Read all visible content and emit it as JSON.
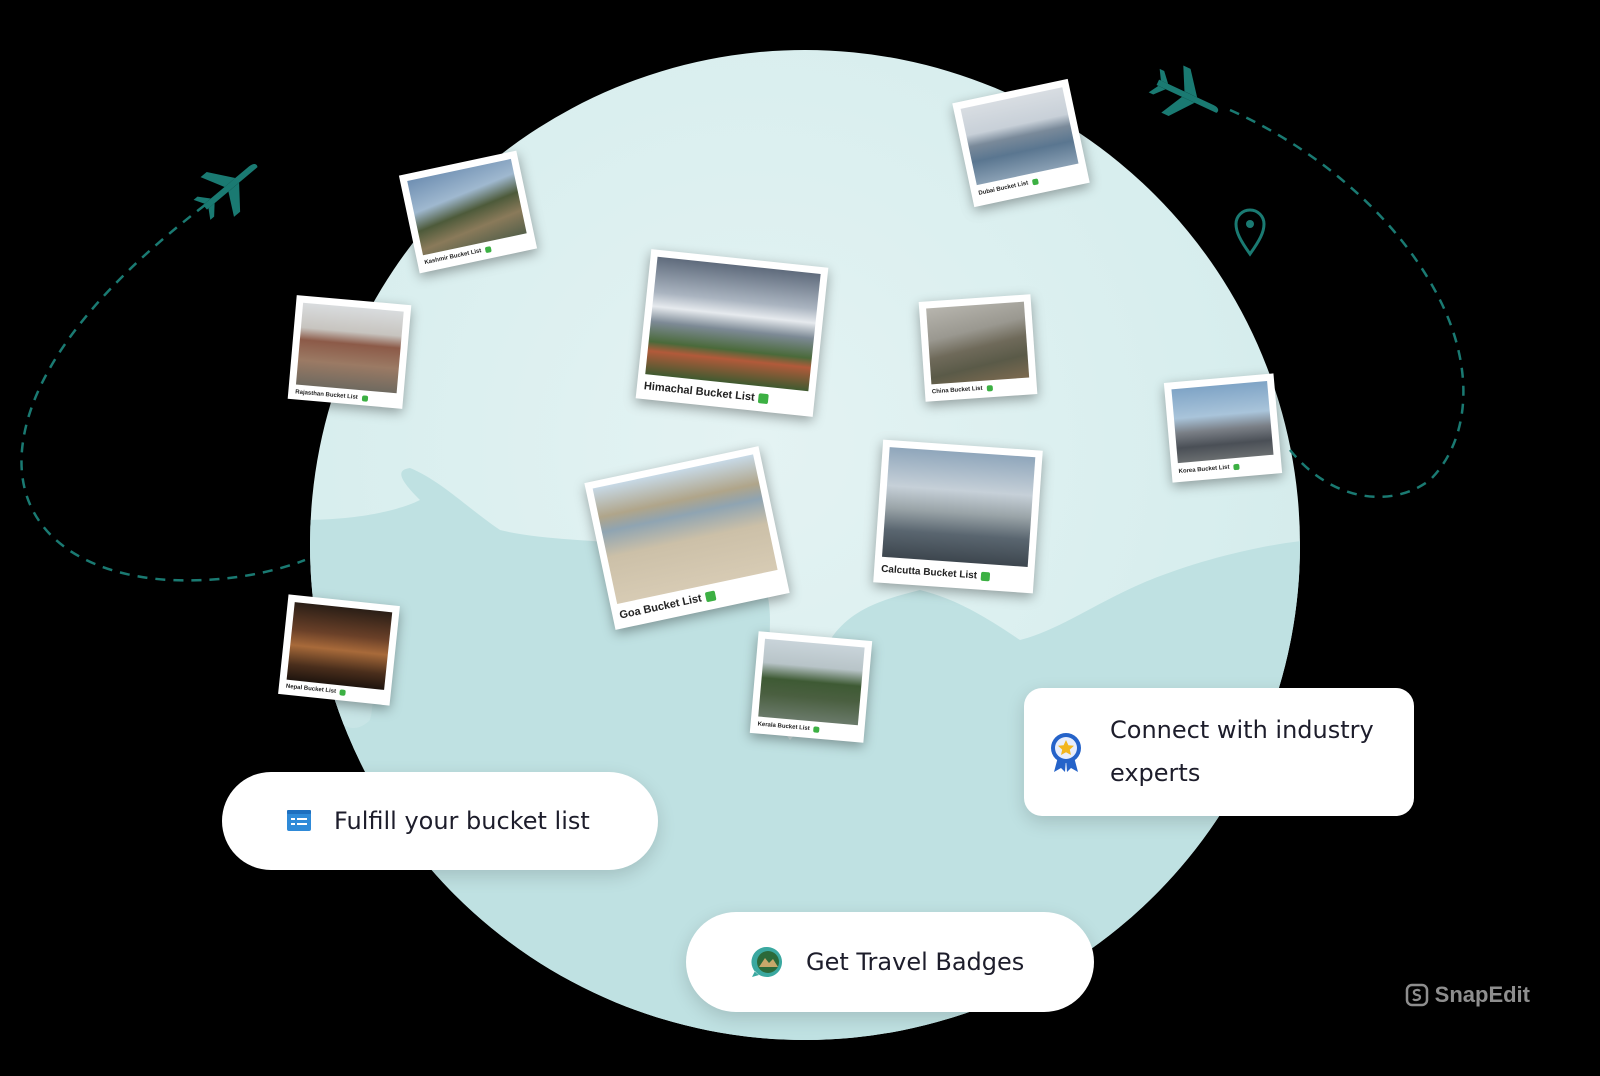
{
  "colors": {
    "accent": "#1a7a72",
    "globe": "#dbefef",
    "land": "#b9dfe0",
    "badge_blue": "#2563c9"
  },
  "photos": [
    {
      "caption": "Kashmir Bucket List",
      "icon": "check-badge-icon"
    },
    {
      "caption": "Rajasthan Bucket List",
      "icon": "check-badge-icon"
    },
    {
      "caption": "Himachal Bucket List",
      "icon": "check-badge-icon"
    },
    {
      "caption": "Dubai Bucket List",
      "icon": "check-badge-icon"
    },
    {
      "caption": "China Bucket List",
      "icon": "check-badge-icon"
    },
    {
      "caption": "Korea Bucket List",
      "icon": "check-badge-icon"
    },
    {
      "caption": "Goa Bucket List",
      "icon": "check-badge-icon"
    },
    {
      "caption": "Calcutta Bucket List",
      "icon": "check-badge-icon"
    },
    {
      "caption": "Nepal Bucket List",
      "icon": "check-badge-icon"
    },
    {
      "caption": "Kerala Bucket List",
      "icon": "check-badge-icon"
    }
  ],
  "features": {
    "bucket_list": {
      "label": "Fulfill your bucket list",
      "icon": "checklist-icon"
    },
    "experts": {
      "label": "Connect with industry experts",
      "icon": "award-ribbon-icon"
    },
    "badges": {
      "label": "Get Travel Badges",
      "icon": "travel-badge-icon"
    }
  },
  "watermark": "SnapEdit"
}
